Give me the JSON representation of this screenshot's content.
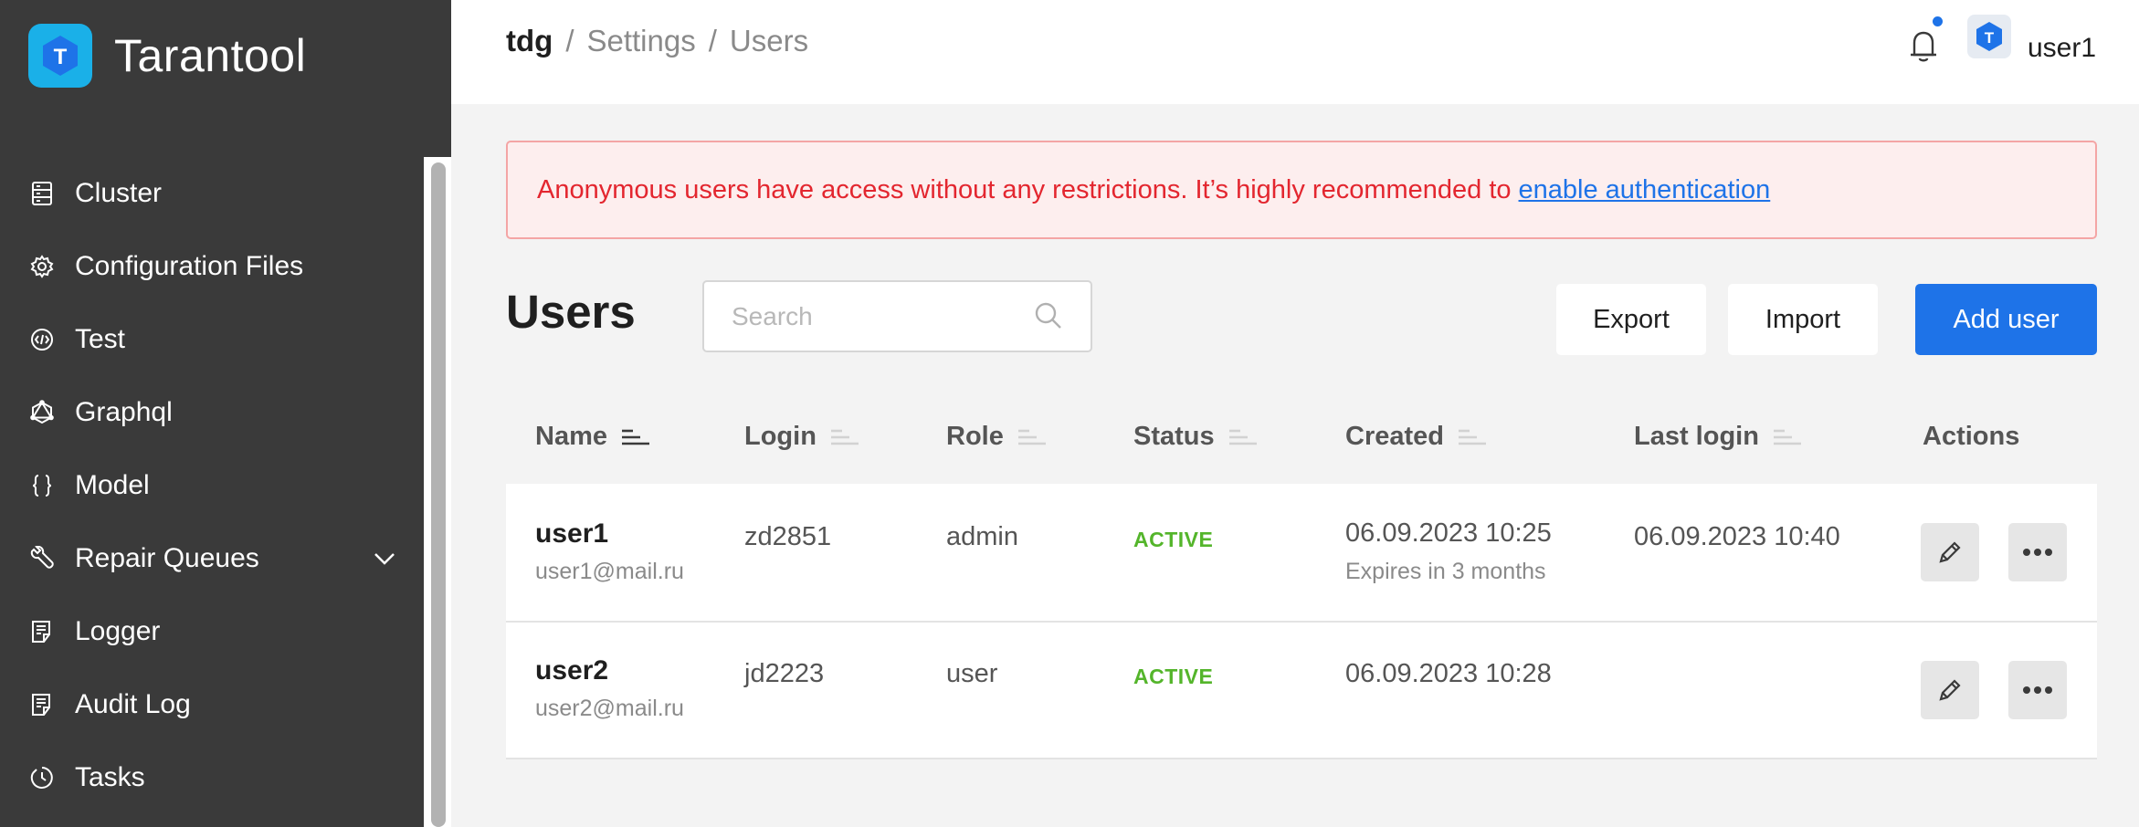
{
  "app": {
    "name": "Tarantool",
    "logo_letter": "T"
  },
  "sidebar": {
    "items": [
      {
        "label": "Cluster",
        "icon": "server-icon"
      },
      {
        "label": "Configuration Files",
        "icon": "gear-icon"
      },
      {
        "label": "Test",
        "icon": "code-icon"
      },
      {
        "label": "Graphql",
        "icon": "graphql-icon"
      },
      {
        "label": "Model",
        "icon": "braces-icon"
      },
      {
        "label": "Repair Queues",
        "icon": "wrench-icon",
        "expandable": true
      },
      {
        "label": "Logger",
        "icon": "document-icon"
      },
      {
        "label": "Audit Log",
        "icon": "document-icon"
      },
      {
        "label": "Tasks",
        "icon": "clock-icon"
      }
    ]
  },
  "header": {
    "breadcrumb": {
      "root": "tdg",
      "separator": "/",
      "items": [
        "Settings",
        "Users"
      ]
    },
    "avatar_letter": "T",
    "username": "user1",
    "notification_color": "#1e73e8"
  },
  "alert": {
    "message": "Anonymous users have access without any restrictions. It’s highly recommended to",
    "link": "enable authentication"
  },
  "page": {
    "title": "Users",
    "search_placeholder": "Search",
    "export_label": "Export",
    "import_label": "Import",
    "add_user_label": "Add user"
  },
  "table": {
    "columns": [
      "Name",
      "Login",
      "Role",
      "Status",
      "Created",
      "Last login",
      "Actions"
    ],
    "rows": [
      {
        "name": "user1",
        "email": "user1@mail.ru",
        "login": "zd2851",
        "role": "admin",
        "status": "ACTIVE",
        "created": "06.09.2023 10:25",
        "expires": "Expires in 3 months",
        "last_login": "06.09.2023 10:40"
      },
      {
        "name": "user2",
        "email": "user2@mail.ru",
        "login": "jd2223",
        "role": "user",
        "status": "ACTIVE",
        "created": "06.09.2023 10:28",
        "expires": "",
        "last_login": ""
      }
    ]
  },
  "colors": {
    "accent": "#1e73e8",
    "active_status": "#54b52b",
    "alert_text": "#e3262f",
    "sidebar_bg": "#3a3a3a"
  }
}
